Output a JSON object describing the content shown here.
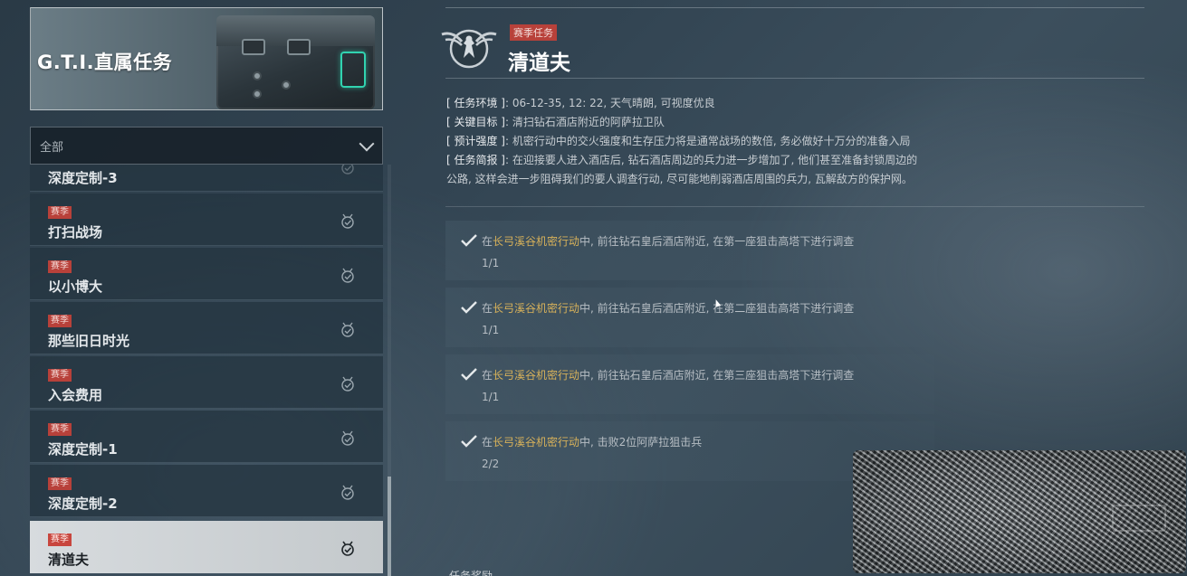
{
  "banner": {
    "title": "G.T.I.直属任务"
  },
  "filter": {
    "selected": "全部"
  },
  "missions": [
    {
      "badge": "",
      "name": "深度定制-3"
    },
    {
      "badge": "赛季",
      "name": "打扫战场"
    },
    {
      "badge": "赛季",
      "name": "以小博大"
    },
    {
      "badge": "赛季",
      "name": "那些旧日时光"
    },
    {
      "badge": "赛季",
      "name": "入会费用"
    },
    {
      "badge": "赛季",
      "name": "深度定制-1"
    },
    {
      "badge": "赛季",
      "name": "深度定制-2"
    },
    {
      "badge": "赛季",
      "name": "清道夫",
      "active": true
    }
  ],
  "detail": {
    "tag": "赛季任务",
    "title": "清道夫",
    "info": {
      "env_key": "[ 任务环境 ]",
      "env_val": ": 06-12-35, 12: 22, 天气晴朗, 可视度优良",
      "target_key": "[ 关键目标 ]",
      "target_val": ": 清扫钻石酒店附近的阿萨拉卫队",
      "intensity_key": "[ 预计强度 ]",
      "intensity_val": ": 机密行动中的交火强度和生存压力将是通常战场的数倍, 务必做好十万分的准备入局",
      "brief_key": "[ 任务简报 ]",
      "brief_val": ": 在迎接要人进入酒店后, 钻石酒店周边的兵力进一步增加了, 他们甚至准备封锁周边的",
      "brief_cont": "公路, 这样会进一步阻碍我们的要人调查行动, 尽可能地削弱酒店周围的兵力, 瓦解敌方的保护网。"
    },
    "objectives": [
      {
        "prefix": "在",
        "location": "长弓溪谷机密行动",
        "task": "中, 前往钻石皇后酒店附近, 在第一座狙击高塔下进行调查",
        "progress": "1/1"
      },
      {
        "prefix": "在",
        "location": "长弓溪谷机密行动",
        "task": "中, 前往钻石皇后酒店附近, 在第二座狙击高塔下进行调查",
        "progress": "1/1"
      },
      {
        "prefix": "在",
        "location": "长弓溪谷机密行动",
        "task": "中, 前往钻石皇后酒店附近, 在第三座狙击高塔下进行调查",
        "progress": "1/1"
      },
      {
        "prefix": "在",
        "location": "长弓溪谷机密行动",
        "task": "中, 击败2位阿萨拉狙击兵",
        "progress": "2/2"
      }
    ],
    "reward_label": "任务奖励"
  },
  "colors": {
    "badge": "#b8413a",
    "location": "#d7b15a",
    "accent_teal": "#31d3b0"
  },
  "icons": [
    "chevron-down-icon",
    "medal-check-icon",
    "eagle-emblem-icon",
    "checkmark-icon"
  ]
}
